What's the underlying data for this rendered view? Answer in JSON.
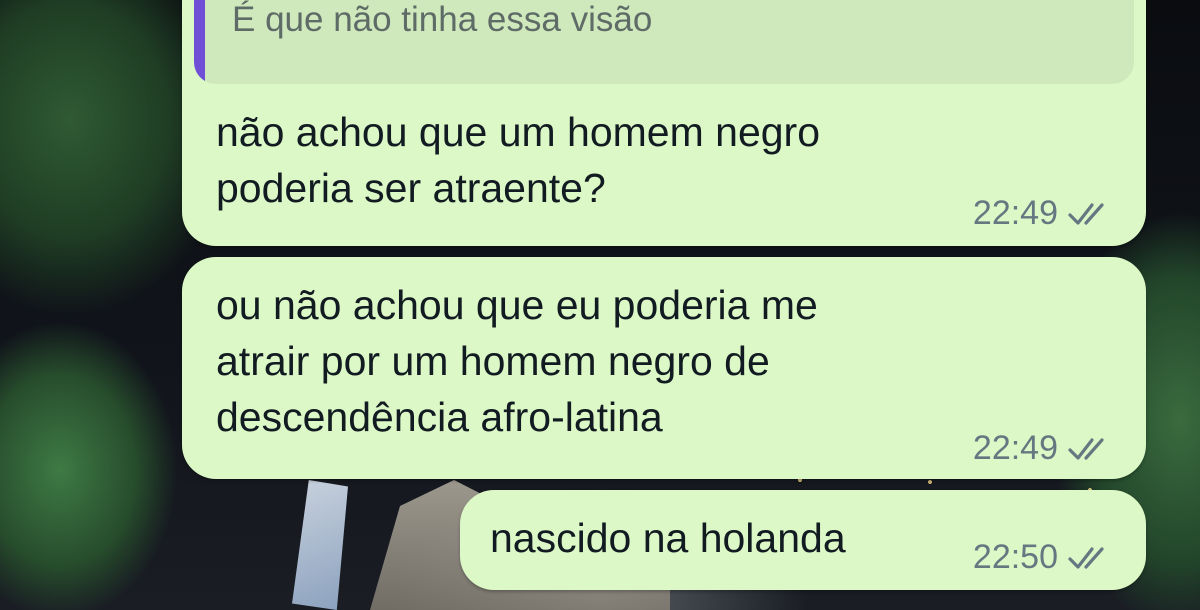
{
  "conversation": {
    "quoted_reply": {
      "text": "É que não tinha essa visão"
    },
    "messages": [
      {
        "text": "não achou que um homem negro\npoderia ser atraente?",
        "time": "22:49",
        "status": "read"
      },
      {
        "text": "ou não achou que eu poderia me\natrair por um homem negro de\ndescendência afro-latina",
        "time": "22:49",
        "status": "read"
      },
      {
        "text": "nascido na holanda",
        "time": "22:50",
        "status": "read"
      }
    ]
  },
  "colors": {
    "outgoing_bubble": "#dcf8c6",
    "quote_background": "#cfe9bd",
    "quote_bar": "#6e4fd6",
    "timestamp": "#667781",
    "message_text": "#111b21"
  },
  "icons": {
    "read_receipt": "double-check-icon"
  }
}
